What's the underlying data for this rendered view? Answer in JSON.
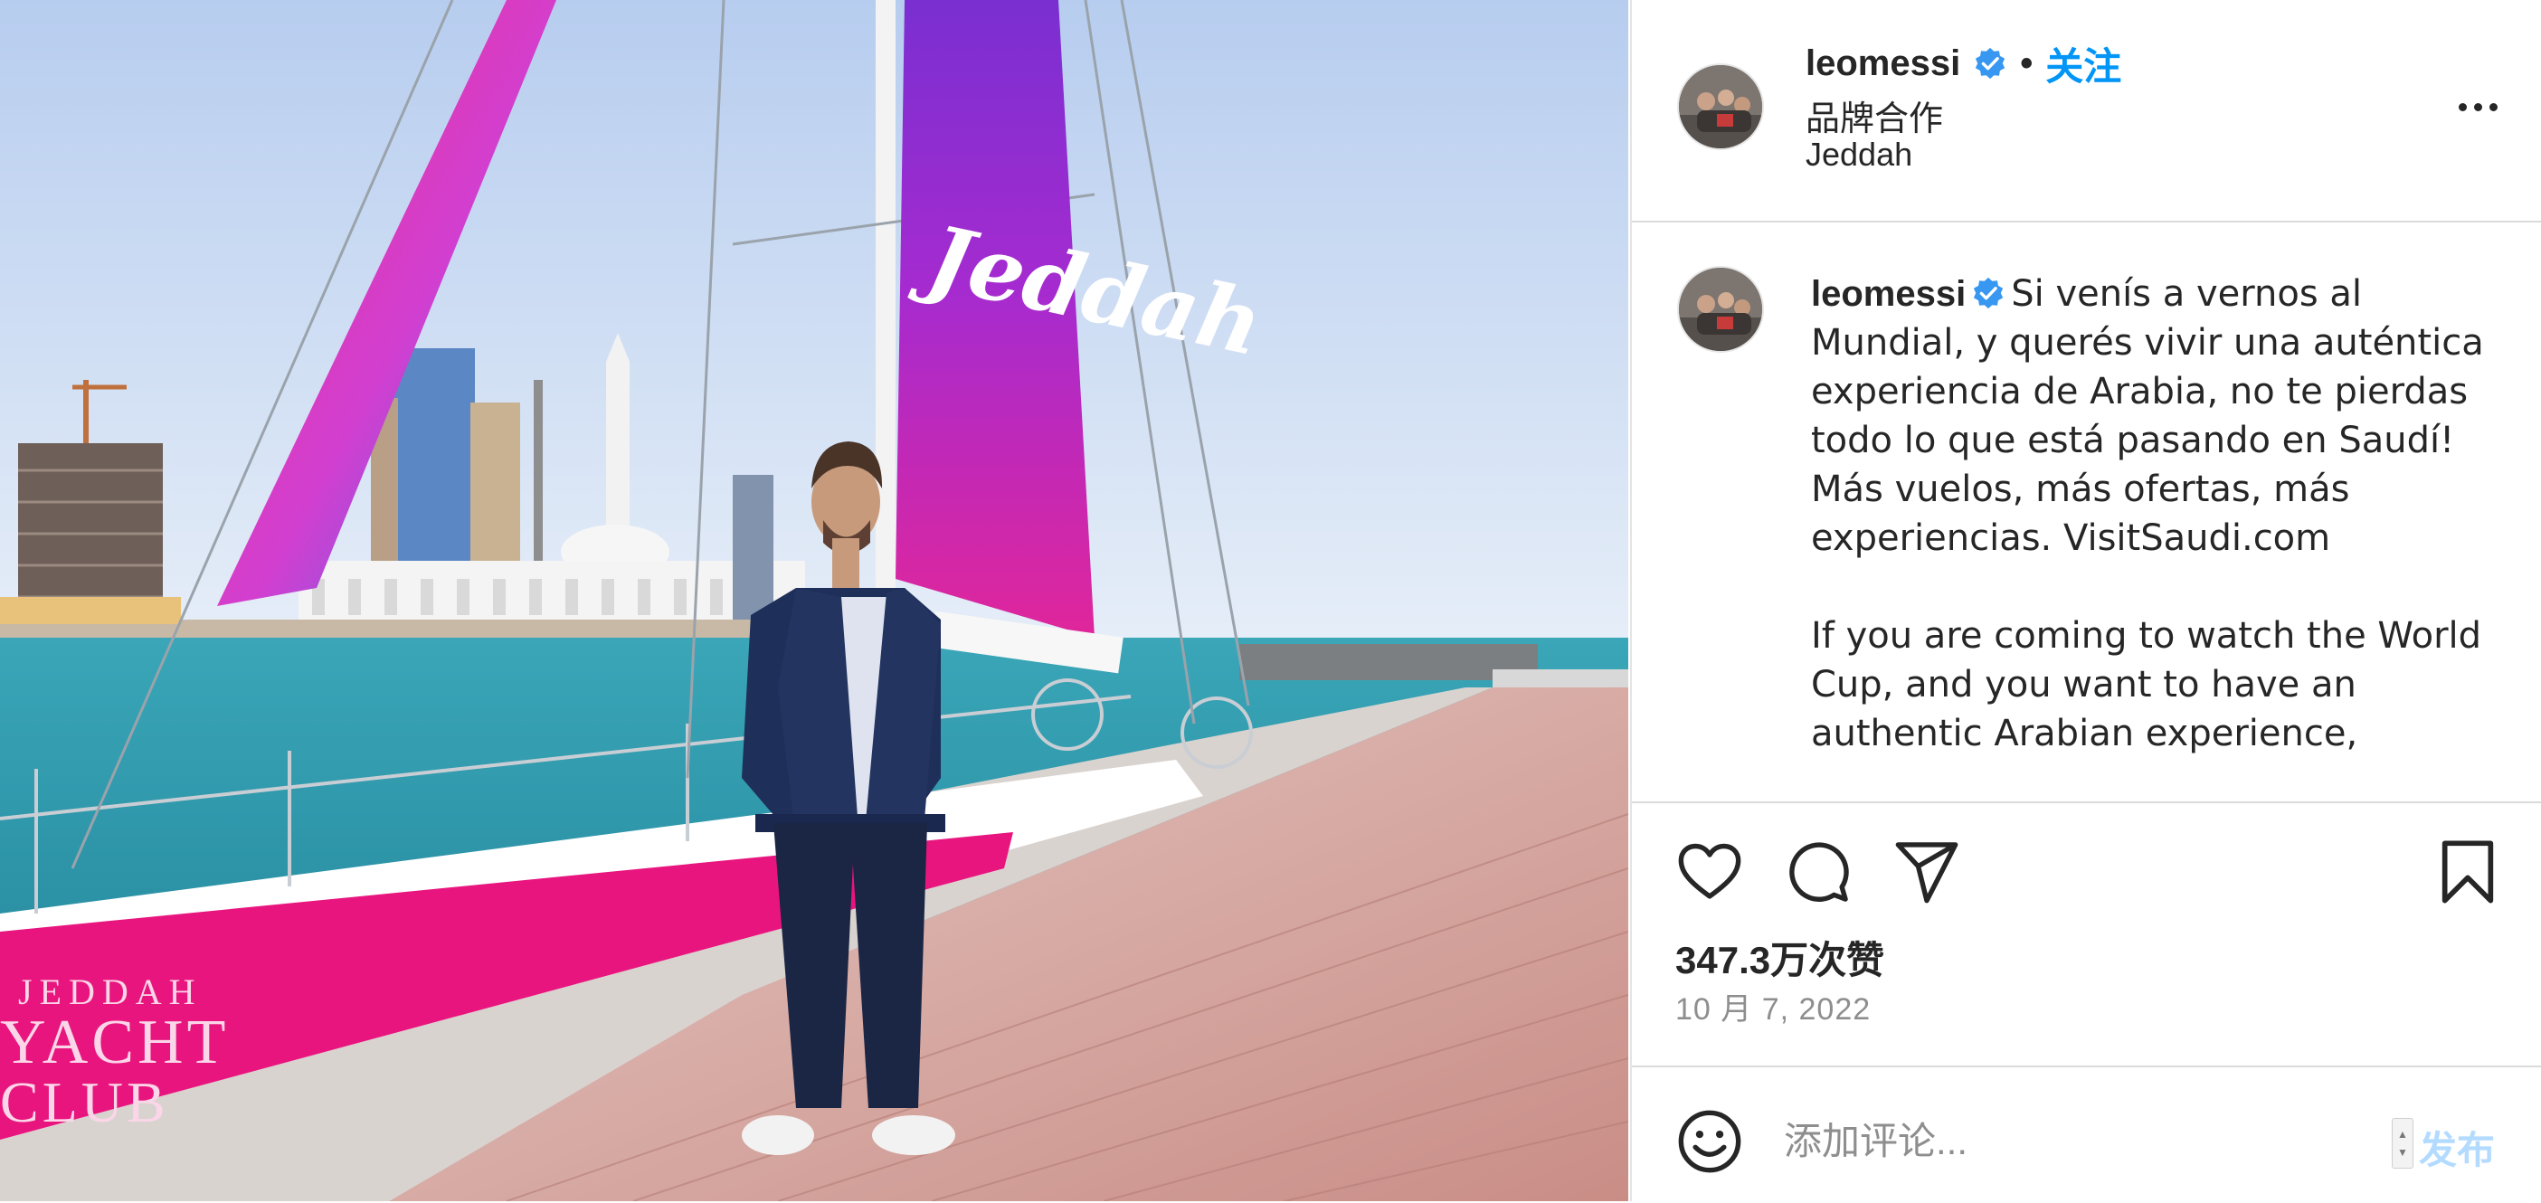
{
  "post": {
    "username": "leomessi",
    "follow_label": "关注",
    "separator": "•",
    "partnership_label": "品牌合作",
    "location": "Jeddah"
  },
  "caption": {
    "username": "leomessi",
    "text": "Si venís a vernos al Mundial, y querés vivir una auténtica experiencia de Arabia, no te pierdas todo lo que está pasando en Saudí!\nMás vuelos, más ofertas, más experiencias. VisitSaudi.com\n\nIf you are coming to watch the World Cup, and you want to have an authentic Arabian experience,"
  },
  "photo": {
    "sail_text": "Jeddah",
    "hull_text_line1": "JEDDAH",
    "hull_text_line2": "YACHT",
    "hull_text_line3": "CLUB"
  },
  "stats": {
    "likes": "347.3万次赞",
    "date": "10 月 7, 2022"
  },
  "comment": {
    "placeholder": "添加评论...",
    "publish_label": "发布"
  },
  "icons": {
    "more": "more-options-icon",
    "like": "heart-icon",
    "comment": "comment-bubble-icon",
    "share": "paper-plane-icon",
    "save": "bookmark-icon",
    "emoji": "emoji-smiley-icon",
    "verified": "verified-badge-icon"
  },
  "colors": {
    "accent": "#0095f6",
    "publish_disabled": "#b3dbff",
    "verified": "#3897f0",
    "sail_pink": "#e8157f",
    "sail_purple": "#8a2be2"
  }
}
